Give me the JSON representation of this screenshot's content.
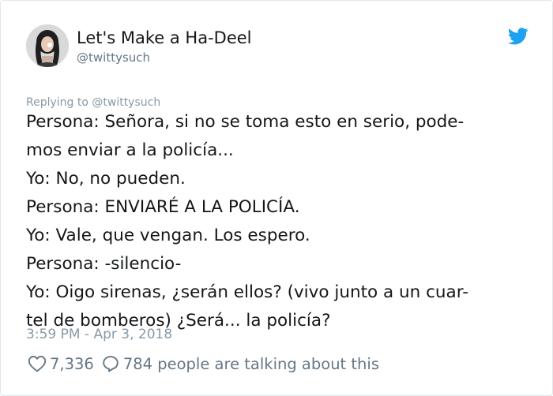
{
  "header": {
    "display_name": "Let's Make a Ha-Deel",
    "handle": "@twittysuch"
  },
  "icons": {
    "brand": "twitter-bird-icon",
    "like": "heart-icon",
    "reply": "speech-bubble-icon"
  },
  "colors": {
    "brand_blue": "#1da1f2",
    "text_primary": "#14171a",
    "text_secondary": "#657786",
    "text_muted": "#8899a6",
    "border": "#e1e8ed"
  },
  "tweet": {
    "replying_to": "Replying to @twittysuch",
    "lines": [
      "Persona: Señora, si no se toma esto en serio, pode-",
      "mos enviar a la policía...",
      "Yo: No, no pueden.",
      "Persona: ENVIARÉ A LA POLICÍA.",
      "Yo: Vale, que vengan. Los espero.",
      "Persona: -silencio-",
      "Yo: Oigo sirenas, ¿serán ellos? (vivo junto a un cuar-",
      "tel de bomberos) ¿Será... la policía?"
    ],
    "timestamp": "3:59 PM - Apr 3, 2018"
  },
  "engagement": {
    "like_count": "7,336",
    "reply_summary": "784 people are talking about this"
  }
}
